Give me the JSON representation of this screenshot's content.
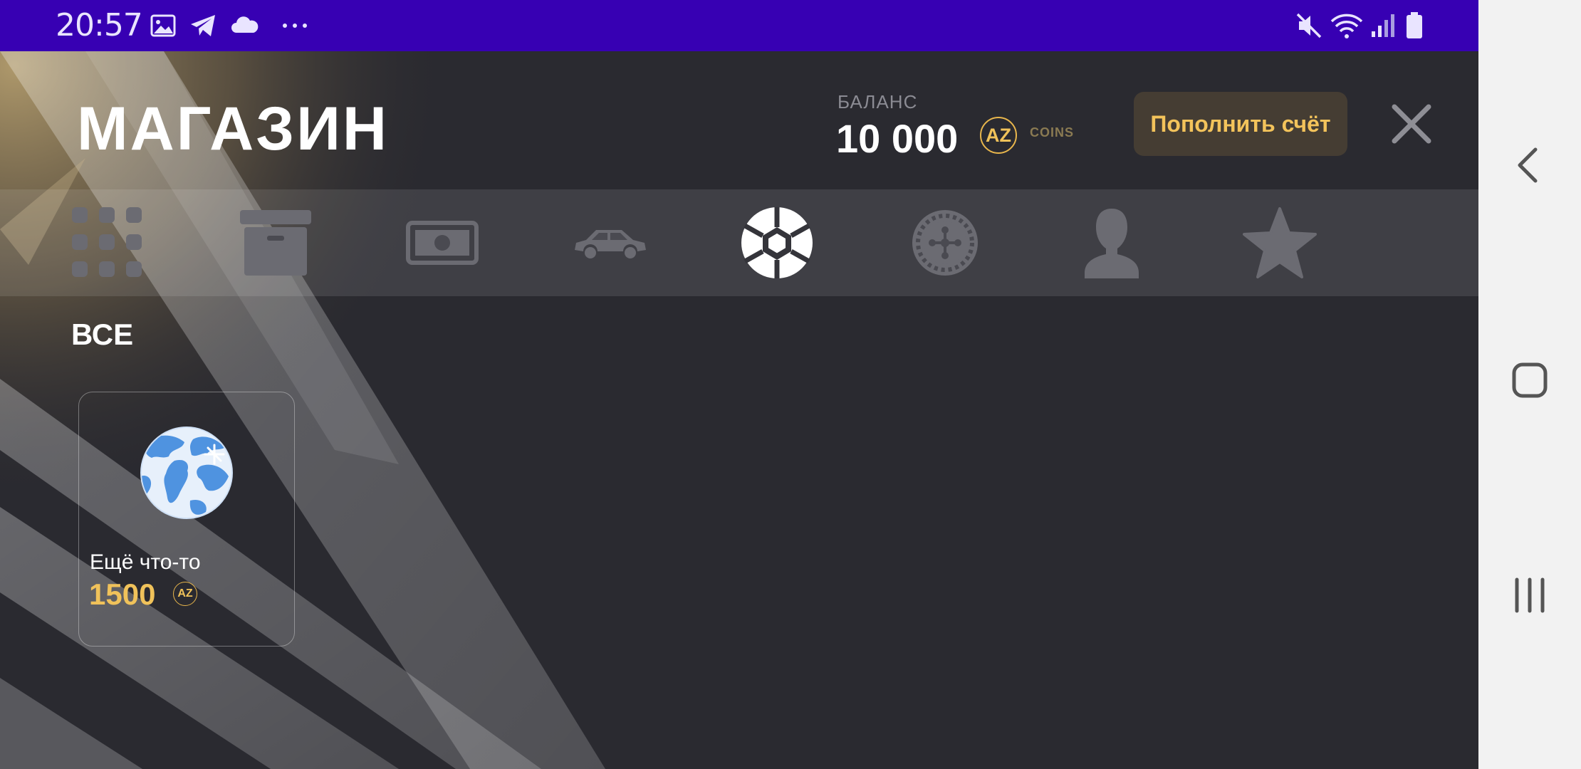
{
  "status_bar": {
    "time": "20:57",
    "left_icons": [
      "gallery-icon",
      "telegram-icon",
      "cloud-icon",
      "more-dots-icon"
    ],
    "right_icons": [
      "mute-icon",
      "wifi-icon",
      "signal-icon",
      "battery-icon"
    ]
  },
  "shop": {
    "title": "МАГАЗИН",
    "balance_label": "БАЛАНС",
    "balance_value": "10 000",
    "currency_badge": "AZ",
    "currency_label": "COINS",
    "topup_label": "Пополнить счёт",
    "categories": [
      {
        "icon": "grid-icon",
        "active": false
      },
      {
        "icon": "box-icon",
        "active": false
      },
      {
        "icon": "money-icon",
        "active": false
      },
      {
        "icon": "car-icon",
        "active": false
      },
      {
        "icon": "soccer-ball-icon",
        "active": true
      },
      {
        "icon": "roulette-icon",
        "active": false
      },
      {
        "icon": "person-icon",
        "active": false
      },
      {
        "icon": "star-icon",
        "active": false
      }
    ],
    "section_title": "ВСЕ",
    "items": [
      {
        "name": "Ещё что-то",
        "price": "1500",
        "currency_badge": "AZ",
        "icon": "globe-icon"
      }
    ]
  },
  "colors": {
    "status_bar": "#3700b3",
    "background": "#2a2a30",
    "accent_gold": "#f0c25a",
    "topup_bg": "#453d33"
  }
}
